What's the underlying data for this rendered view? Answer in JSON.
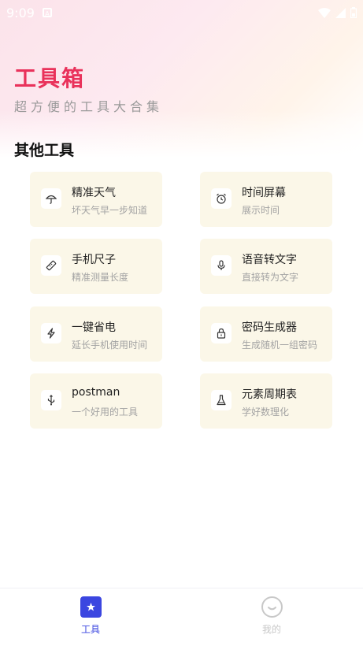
{
  "status_bar": {
    "time": "9:09",
    "notification": "A"
  },
  "header": {
    "title": "工具箱",
    "subtitle": "超方便的工具大合集"
  },
  "section": {
    "title": "其他工具"
  },
  "tools": [
    {
      "name": "精准天气",
      "desc": "坏天气早一步知道",
      "icon": "umbrella-icon"
    },
    {
      "name": "时间屏幕",
      "desc": "展示时间",
      "icon": "alarm-clock-icon"
    },
    {
      "name": "手机尺子",
      "desc": "精准测量长度",
      "icon": "ruler-icon"
    },
    {
      "name": "语音转文字",
      "desc": "直接转为文字",
      "icon": "microphone-icon"
    },
    {
      "name": "一键省电",
      "desc": "延长手机使用时间",
      "icon": "lightning-icon"
    },
    {
      "name": "密码生成器",
      "desc": "生成随机一组密码",
      "icon": "lock-icon"
    },
    {
      "name": "postman",
      "desc": "一个好用的工具",
      "icon": "usb-icon"
    },
    {
      "name": "元素周期表",
      "desc": "学好数理化",
      "icon": "flask-icon"
    }
  ],
  "bottom_nav": {
    "tools_label": "工具",
    "mine_label": "我的",
    "active_color": "#3b46e0",
    "inactive_color": "#c8c8c8"
  },
  "colors": {
    "title": "#e9325b",
    "card_bg": "#fbf7e8"
  }
}
